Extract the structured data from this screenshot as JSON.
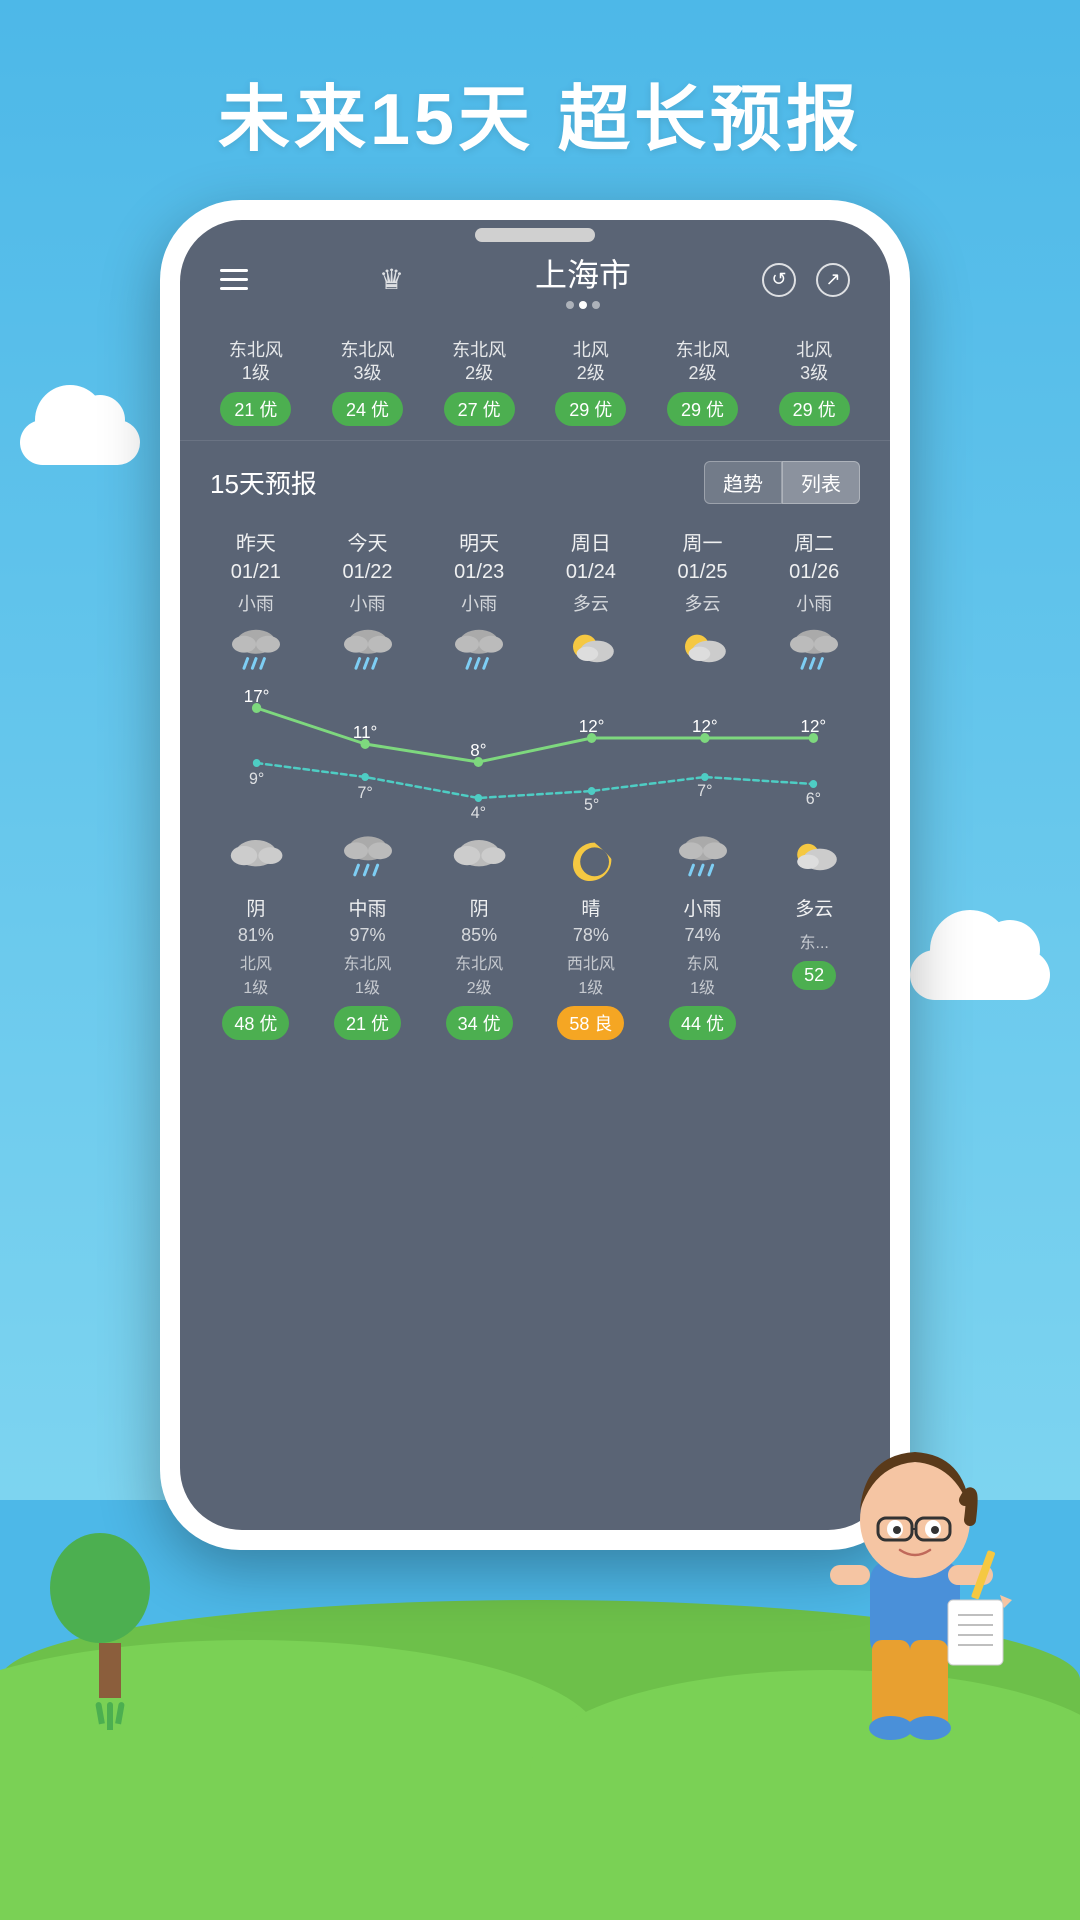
{
  "page": {
    "title": "未来15天  超长预报",
    "background_color": "#4db8e8"
  },
  "phone": {
    "city": "上海市",
    "city_dots": [
      false,
      true,
      false
    ],
    "top_buttons": [
      "refresh",
      "share"
    ],
    "air_quality_items": [
      {
        "wind": "东北风\n1级",
        "badge": "21 优",
        "badge_type": "green"
      },
      {
        "wind": "东北风\n3级",
        "badge": "24 优",
        "badge_type": "green"
      },
      {
        "wind": "东北风\n2级",
        "badge": "27 优",
        "badge_type": "green"
      },
      {
        "wind": "北风\n2级",
        "badge": "29 优",
        "badge_type": "green"
      },
      {
        "wind": "东北风\n2级",
        "badge": "29 优",
        "badge_type": "green"
      },
      {
        "wind": "北风\n3级",
        "badge": "29 优",
        "badge_type": "green"
      }
    ],
    "forecast_section_title": "15天预报",
    "forecast_tabs": [
      "趋势",
      "列表"
    ],
    "forecast_days": [
      {
        "label": "昨天\n01/21",
        "condition": "小雨",
        "icon": "rain",
        "high": "17°",
        "low": "9°"
      },
      {
        "label": "今天\n01/22",
        "condition": "小雨",
        "icon": "rain",
        "high": "11°",
        "low": "7°"
      },
      {
        "label": "明天\n01/23",
        "condition": "小雨",
        "icon": "rain",
        "high": "8°",
        "low": "4°"
      },
      {
        "label": "周日\n01/24",
        "condition": "多云",
        "icon": "partly-cloudy",
        "high": "12°",
        "low": "5°"
      },
      {
        "label": "周一\n01/25",
        "condition": "多云",
        "icon": "partly-cloudy",
        "high": "12°",
        "low": "7°"
      },
      {
        "label": "周二\n01/26",
        "condition": "小雨",
        "icon": "rain",
        "high": "12°",
        "low": "6°"
      }
    ],
    "bottom_days": [
      {
        "icon": "cloudy",
        "condition": "阴",
        "percent": "81%",
        "wind": "北风\n1级",
        "badge": "48 优",
        "badge_type": "green"
      },
      {
        "icon": "rain",
        "condition": "中雨",
        "percent": "97%",
        "wind": "东北风\n1级",
        "badge": "21 优",
        "badge_type": "green"
      },
      {
        "icon": "cloudy",
        "condition": "阴",
        "percent": "85%",
        "wind": "东北风\n2级",
        "badge": "34 优",
        "badge_type": "green"
      },
      {
        "icon": "moon",
        "condition": "晴",
        "percent": "78%",
        "wind": "西北风\n1级",
        "badge": "58 良",
        "badge_type": "yellow"
      },
      {
        "icon": "rain-small",
        "condition": "小雨",
        "percent": "74%",
        "wind": "东风\n1级",
        "badge": "44 优",
        "badge_type": "green"
      },
      {
        "icon": "partly-cloudy-small",
        "condition": "多云",
        "percent": "",
        "wind": "东...",
        "badge": "52",
        "badge_type": "green"
      }
    ]
  }
}
